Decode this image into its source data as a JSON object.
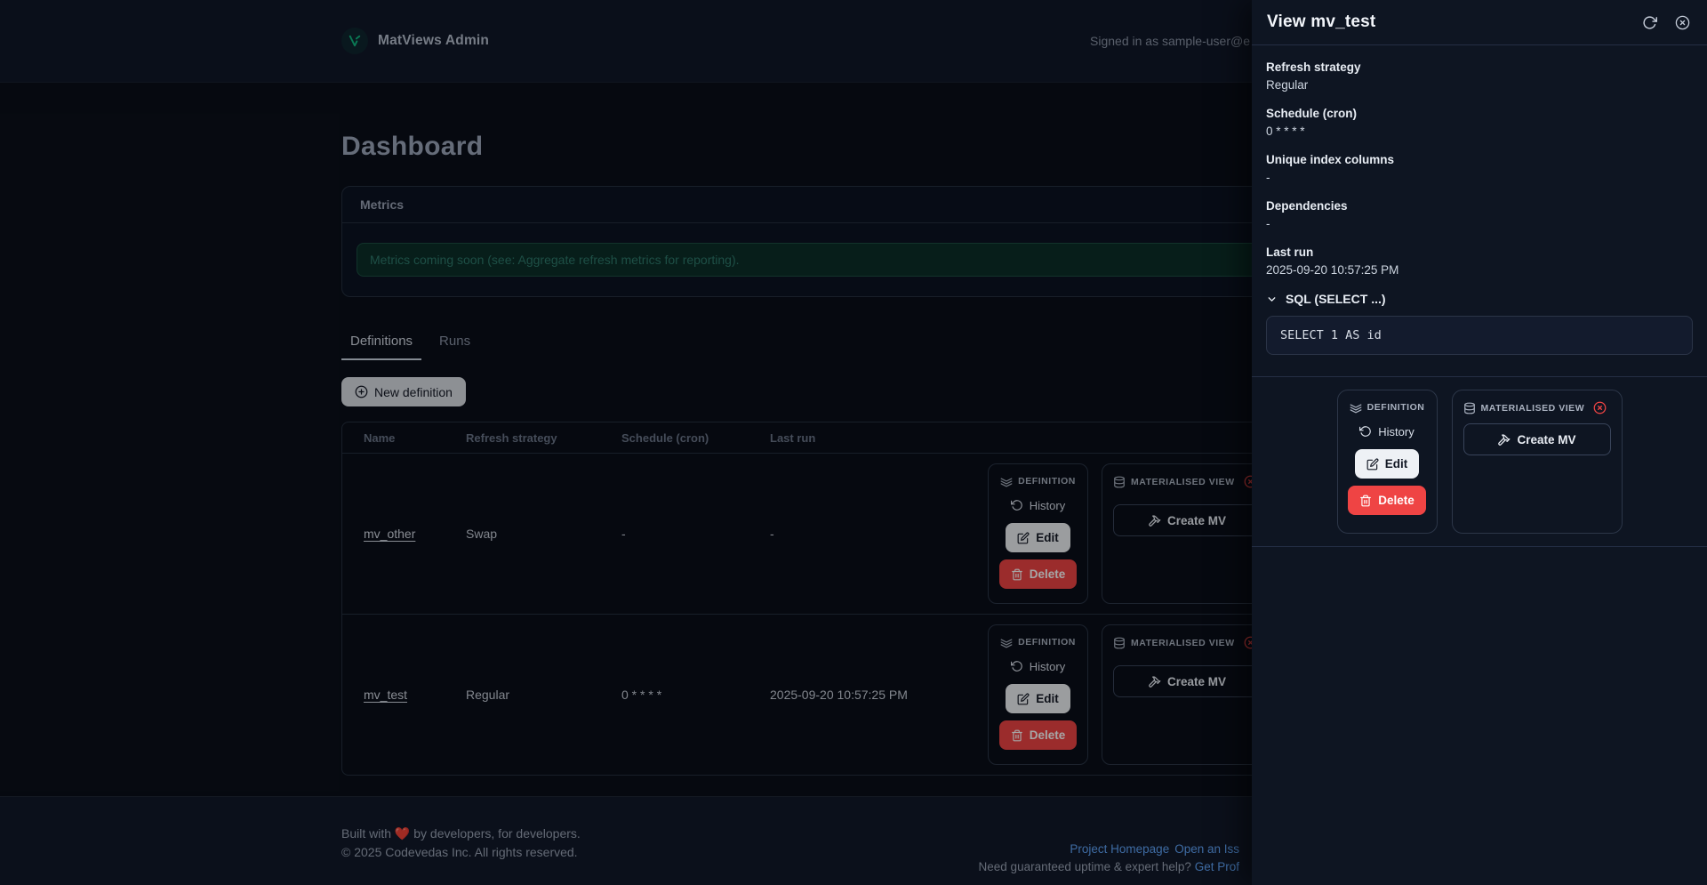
{
  "header": {
    "brand": "MatViews Admin",
    "signed_in": "Signed in as sample-user@e"
  },
  "page": {
    "title": "Dashboard"
  },
  "metrics": {
    "title": "Metrics",
    "notice": "Metrics coming soon (see: Aggregate refresh metrics for reporting)."
  },
  "tabs": {
    "definitions": "Definitions",
    "runs": "Runs"
  },
  "toolbar": {
    "new_definition": "New definition"
  },
  "table": {
    "columns": [
      "Name",
      "Refresh strategy",
      "Schedule (cron)",
      "Last run"
    ],
    "rows": [
      {
        "name": "mv_other",
        "strategy": "Swap",
        "schedule": "-",
        "last_run": "-"
      },
      {
        "name": "mv_test",
        "strategy": "Regular",
        "schedule": "0 * * * *",
        "last_run": "2025-09-20 10:57:25 PM"
      }
    ]
  },
  "labels": {
    "definition": "DEFINITION",
    "materialised_view": "MATERIALISED VIEW",
    "history": "History",
    "edit": "Edit",
    "delete": "Delete",
    "create_mv": "Create MV"
  },
  "drawer": {
    "title": "View mv_test",
    "fields": [
      {
        "label": "Refresh strategy",
        "value": "Regular"
      },
      {
        "label": "Schedule (cron)",
        "value": "0 * * * *"
      },
      {
        "label": "Unique index columns",
        "value": "-"
      },
      {
        "label": "Dependencies",
        "value": "-"
      },
      {
        "label": "Last run",
        "value": "2025-09-20 10:57:25 PM"
      }
    ],
    "sql": {
      "summary": "SQL (SELECT ...)",
      "code": "SELECT 1 AS id"
    }
  },
  "footer": {
    "made": "Built with ❤️ by developers, for developers.",
    "copyright": "© 2025 Codevedas Inc. All rights reserved.",
    "link_homepage": "Project Homepage",
    "link_issue": "Open an Iss",
    "help_text": "Need guaranteed uptime & expert help?",
    "help_link": "Get Prof"
  },
  "colors": {
    "accent": "#10b981",
    "danger": "#ef4444",
    "link": "#60a5fa"
  }
}
